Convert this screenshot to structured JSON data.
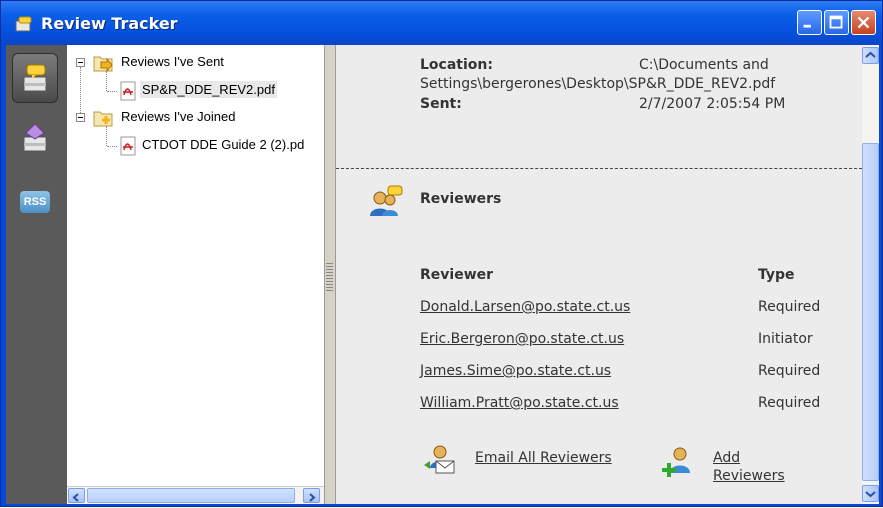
{
  "window": {
    "title": "Review Tracker"
  },
  "sidebar": {
    "rss_label": "RSS"
  },
  "tree": {
    "sent_label": "Reviews I've Sent",
    "sent_file": "SP&R_DDE_REV2.pdf",
    "joined_label": "Reviews I've Joined",
    "joined_file": "CTDOT DDE Guide 2 (2).pd"
  },
  "details": {
    "location_label": "Location:",
    "location_value_line1": "C:\\Documents and",
    "location_value_line2": "Settings\\bergerones\\Desktop\\SP&R_DDE_REV2.pdf",
    "sent_label": "Sent:",
    "sent_value": "2/7/2007 2:05:54 PM"
  },
  "reviewers": {
    "heading": "Reviewers",
    "col_reviewer": "Reviewer",
    "col_type": "Type",
    "rows": [
      {
        "email": "Donald.Larsen@po.state.ct.us",
        "type": "Required"
      },
      {
        "email": "Eric.Bergeron@po.state.ct.us",
        "type": "Initiator"
      },
      {
        "email": "James.Sime@po.state.ct.us",
        "type": "Required"
      },
      {
        "email": "William.Pratt@po.state.ct.us",
        "type": "Required"
      }
    ],
    "email_all": "Email All Reviewers",
    "add_line1": "Add",
    "add_line2": "Reviewers"
  },
  "colors": {
    "titlebar": "#0a5fe8",
    "sidebar": "#5a5a5a",
    "pane_bg": "#ececec"
  }
}
